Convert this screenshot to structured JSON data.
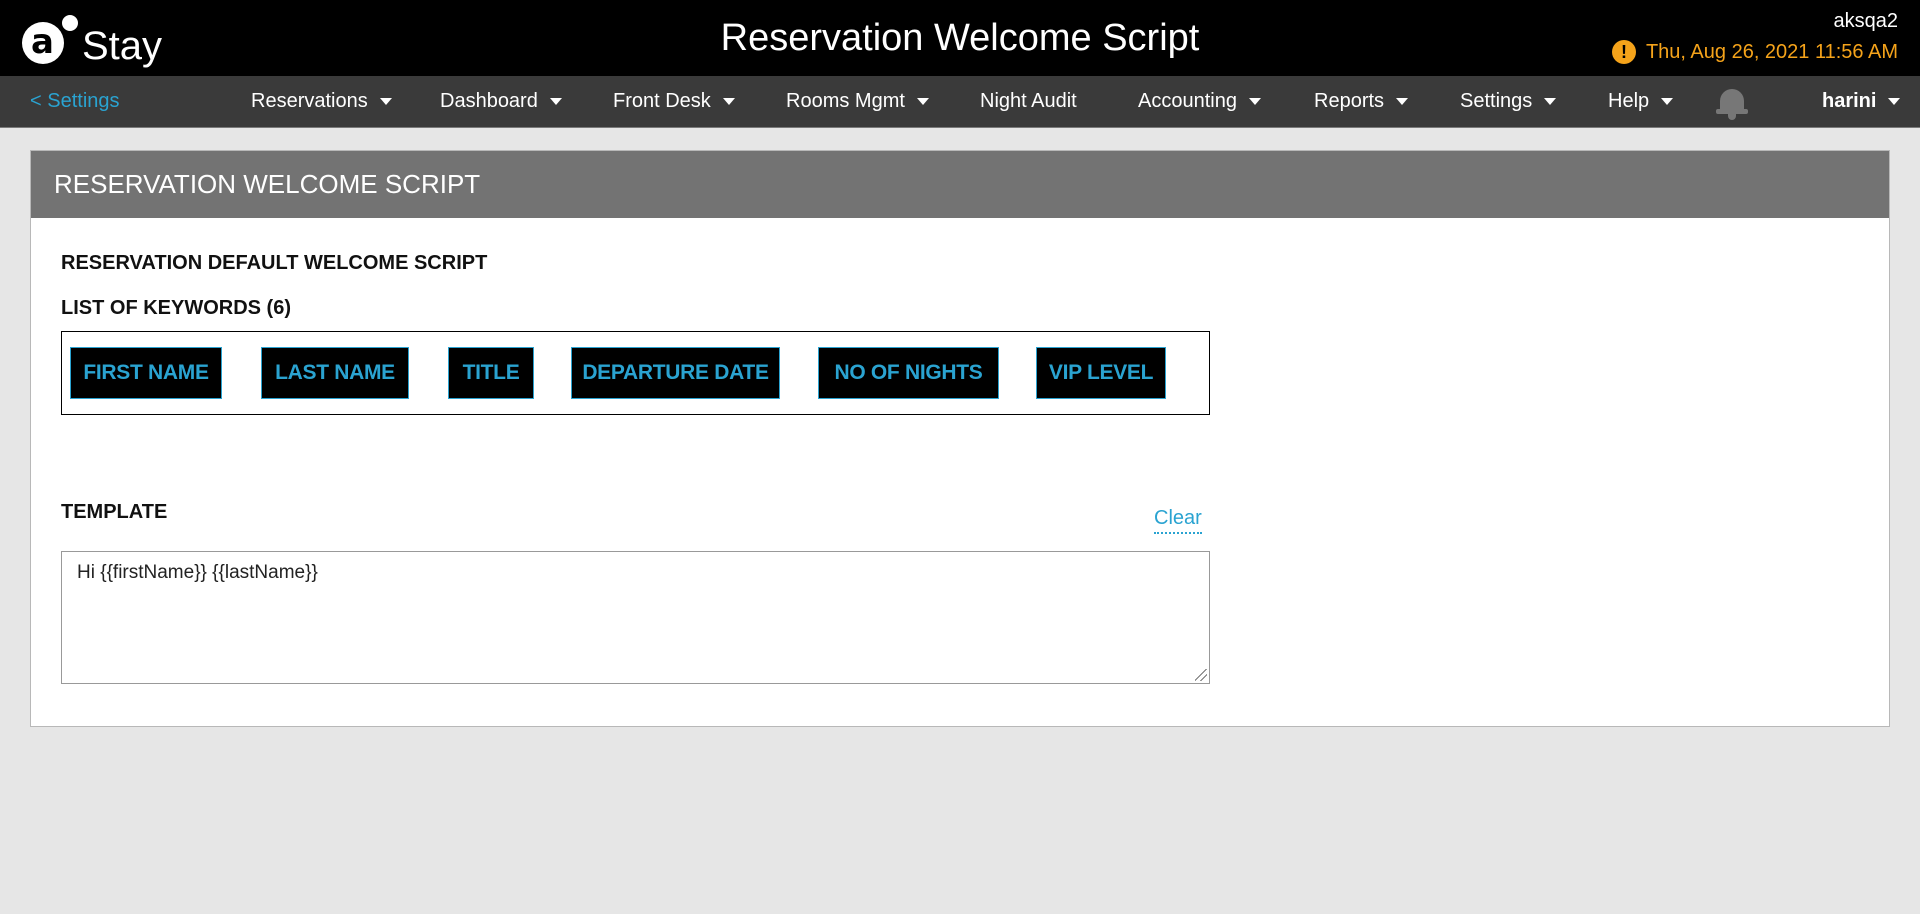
{
  "header": {
    "logo_letter": "a",
    "logo_text": "Stay",
    "title": "Reservation Welcome Script",
    "user_code": "aksqa2",
    "datetime": "Thu, Aug 26, 2021 11:56 AM",
    "warning_icon": "!",
    "warning_color": "#f5a31a"
  },
  "nav": {
    "back_label": "< Settings",
    "items": [
      {
        "label": "Reservations"
      },
      {
        "label": "Dashboard"
      },
      {
        "label": "Front Desk"
      },
      {
        "label": "Rooms Mgmt"
      },
      {
        "label": "Night Audit"
      },
      {
        "label": "Accounting"
      },
      {
        "label": "Reports"
      },
      {
        "label": "Settings"
      },
      {
        "label": "Help"
      }
    ],
    "bell_icon": "bell-icon",
    "user": "harini"
  },
  "panel": {
    "title": "RESERVATION WELCOME SCRIPT",
    "default_label": "RESERVATION DEFAULT WELCOME SCRIPT",
    "keywords_label": "LIST OF KEYWORDS (6)",
    "keywords": [
      "FIRST NAME",
      "LAST NAME",
      "TITLE",
      "DEPARTURE DATE",
      "NO OF NIGHTS",
      "VIP LEVEL"
    ],
    "template_label": "TEMPLATE",
    "clear_label": "Clear",
    "template_value": "Hi {{firstName}} {{lastName}}"
  },
  "colors": {
    "accent": "#2aa3d1",
    "topbar": "#000000",
    "navbar": "#3a3a3a",
    "panel_header": "#737373"
  }
}
